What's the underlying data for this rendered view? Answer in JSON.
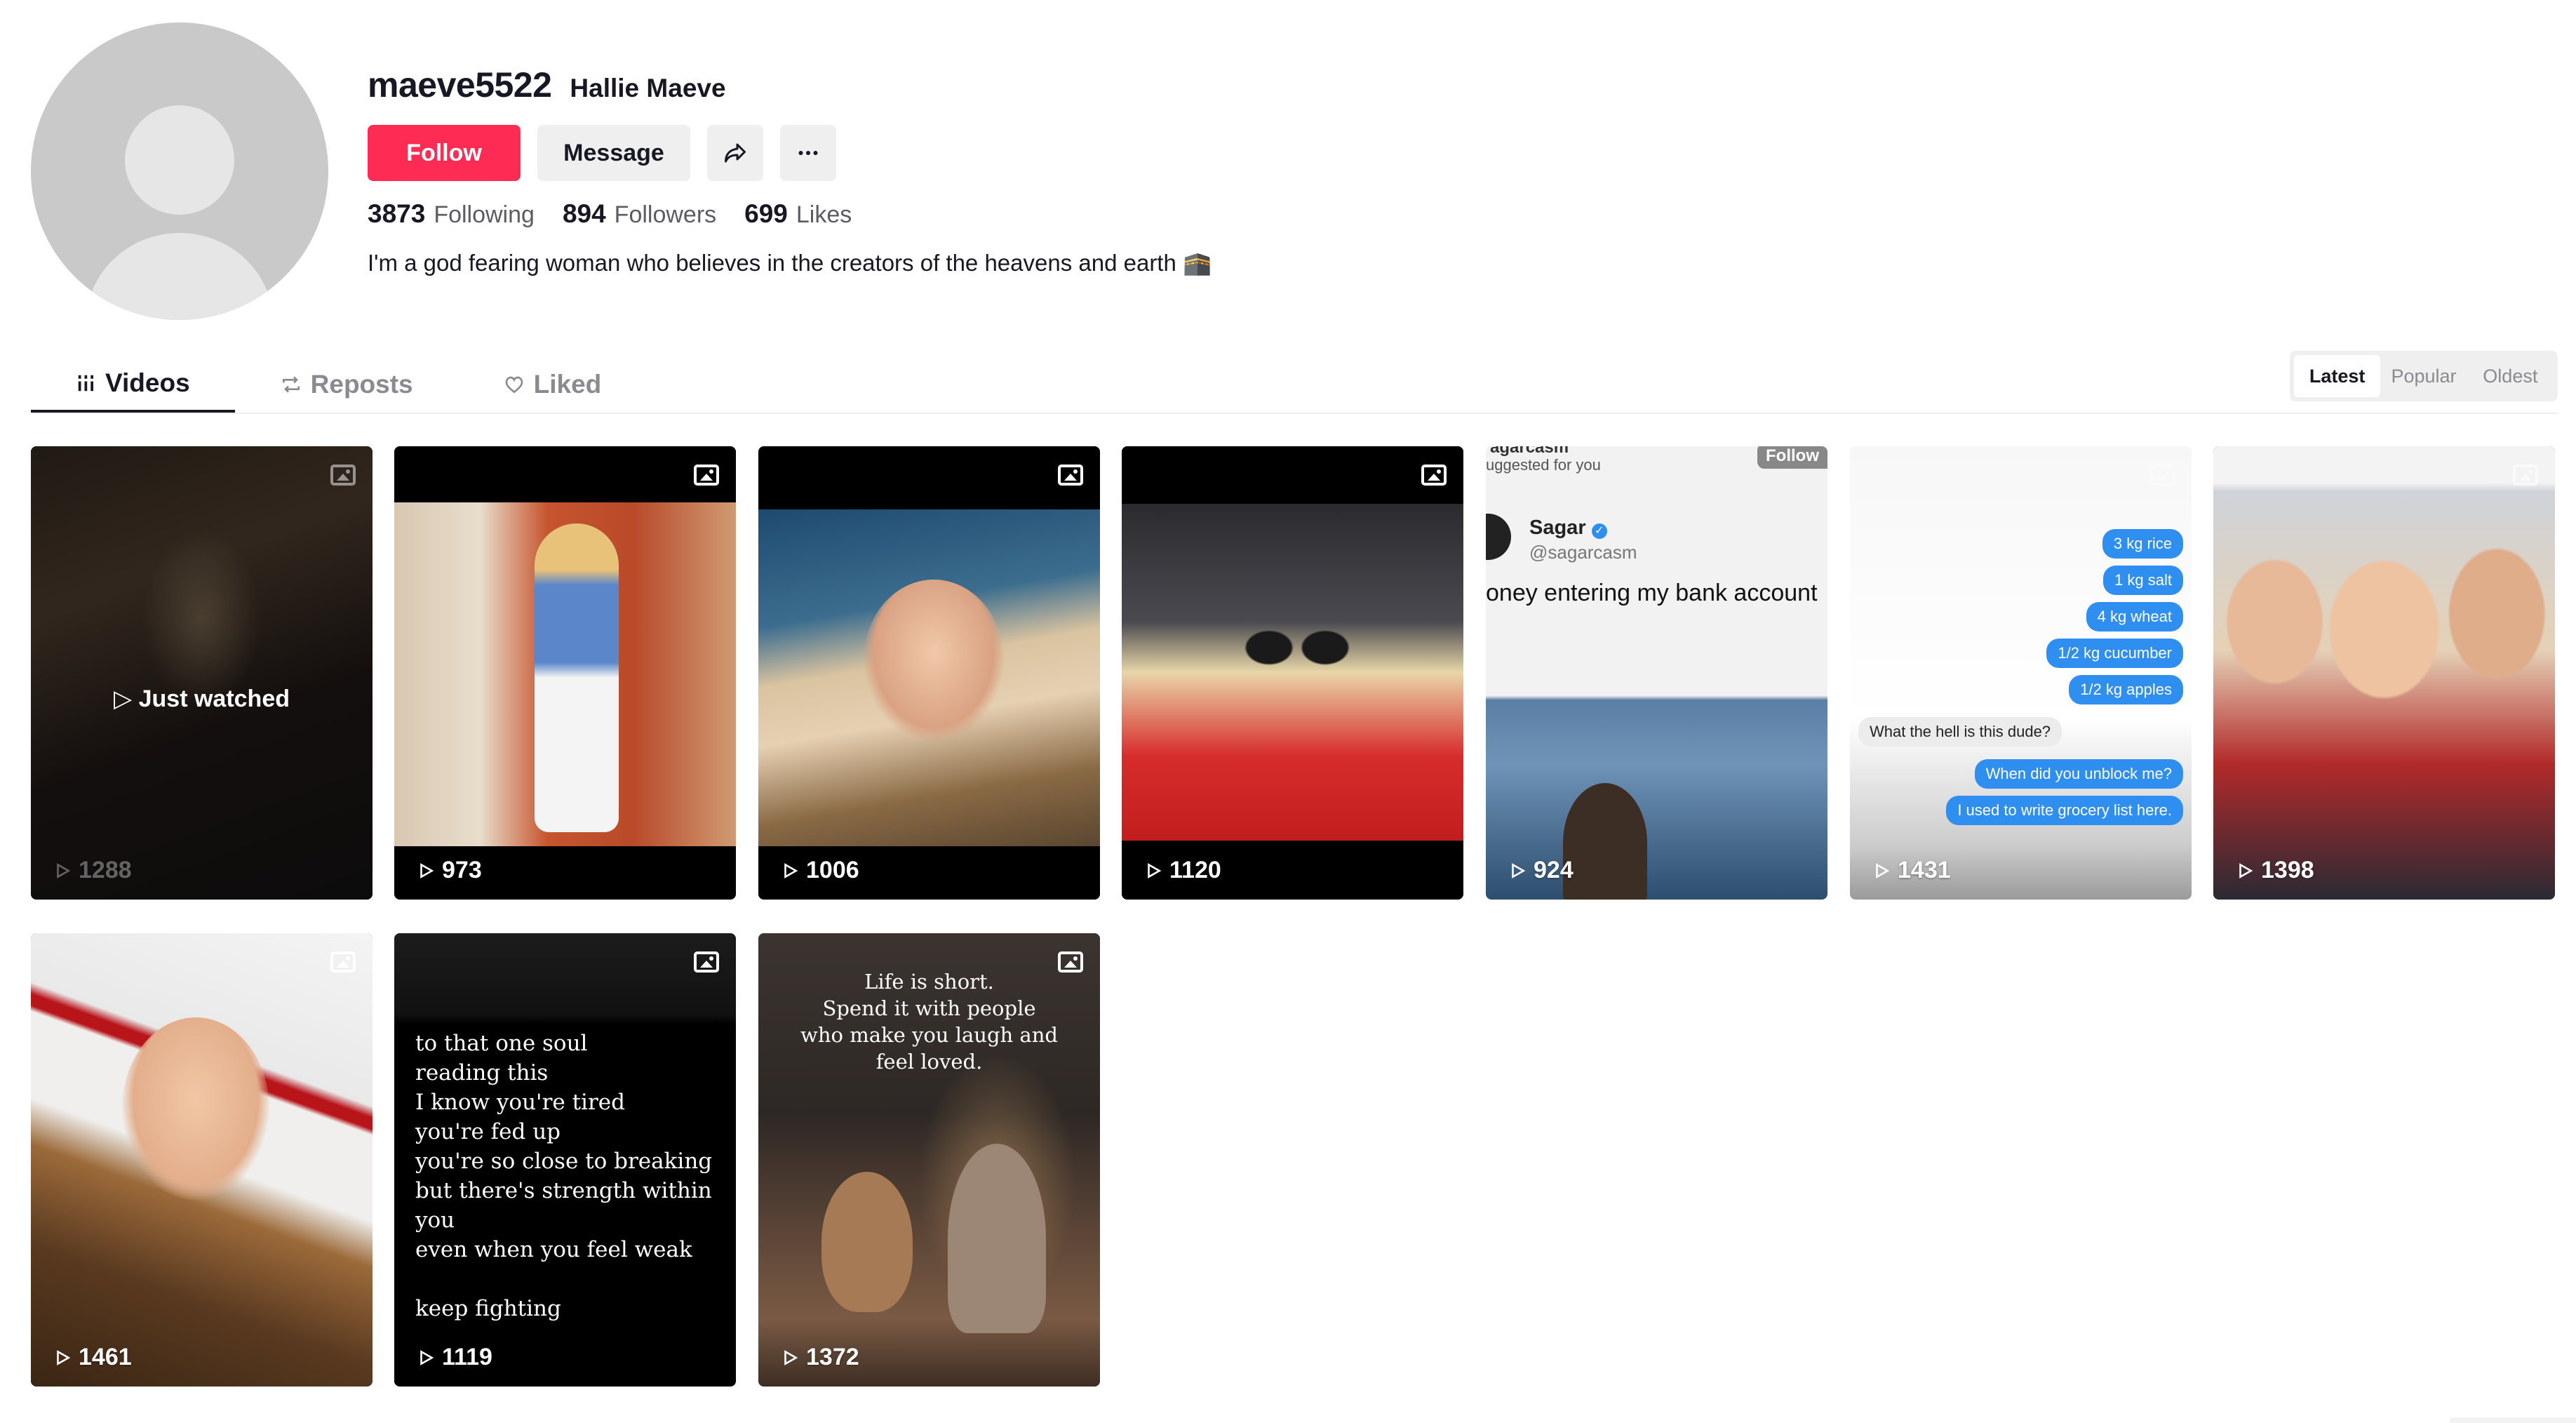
{
  "profile": {
    "username": "maeve5522",
    "nickname": "Hallie Maeve",
    "follow_label": "Follow",
    "message_label": "Message",
    "stats": {
      "following_count": "3873",
      "following_label": "Following",
      "followers_count": "894",
      "followers_label": "Followers",
      "likes_count": "699",
      "likes_label": "Likes"
    },
    "bio": "I'm a god fearing woman who believes in the creators of the heavens and earth 🕋"
  },
  "tabs": [
    {
      "label": "Videos",
      "icon": "grid-icon",
      "active": true
    },
    {
      "label": "Reposts",
      "icon": "repost-icon",
      "active": false
    },
    {
      "label": "Liked",
      "icon": "heart-icon",
      "active": false
    }
  ],
  "sort": {
    "options": [
      "Latest",
      "Popular",
      "Oldest"
    ],
    "selected": "Latest"
  },
  "videos": [
    {
      "plays": "1288",
      "overlay": "Just watched"
    },
    {
      "plays": "973"
    },
    {
      "plays": "1006"
    },
    {
      "plays": "1120"
    },
    {
      "plays": "924",
      "post": {
        "header_fragment": "agarcasm",
        "suggested": "uggested for you",
        "follow_fragment": "Follow",
        "author": "Sagar",
        "handle": "@sagarcasm",
        "text": "oney entering my bank account"
      }
    },
    {
      "plays": "1431",
      "chat": {
        "right": [
          "3 kg rice",
          "1 kg salt",
          "4 kg wheat",
          "1/2 kg cucumber",
          "1/2 kg apples"
        ],
        "left": "What the hell is this dude?",
        "right2": [
          "When did you unblock me?",
          "I used to write grocery list here."
        ]
      }
    },
    {
      "plays": "1398"
    },
    {
      "plays": "1461"
    },
    {
      "plays": "1119",
      "quote_lines": [
        "to that one soul",
        "reading this",
        "I know you're tired",
        "you're fed up",
        "you're so close to breaking",
        "but there's strength within you",
        "even when you feel weak",
        "",
        "keep fighting"
      ]
    },
    {
      "plays": "1372",
      "quote_lines": [
        "Life is short.",
        "Spend it with people",
        "who make you laugh and",
        "feel loved."
      ]
    }
  ],
  "colors": {
    "accent": "#fe2c55",
    "text": "#161823",
    "muted": "#8a8b91",
    "button_bg": "#efefef"
  }
}
